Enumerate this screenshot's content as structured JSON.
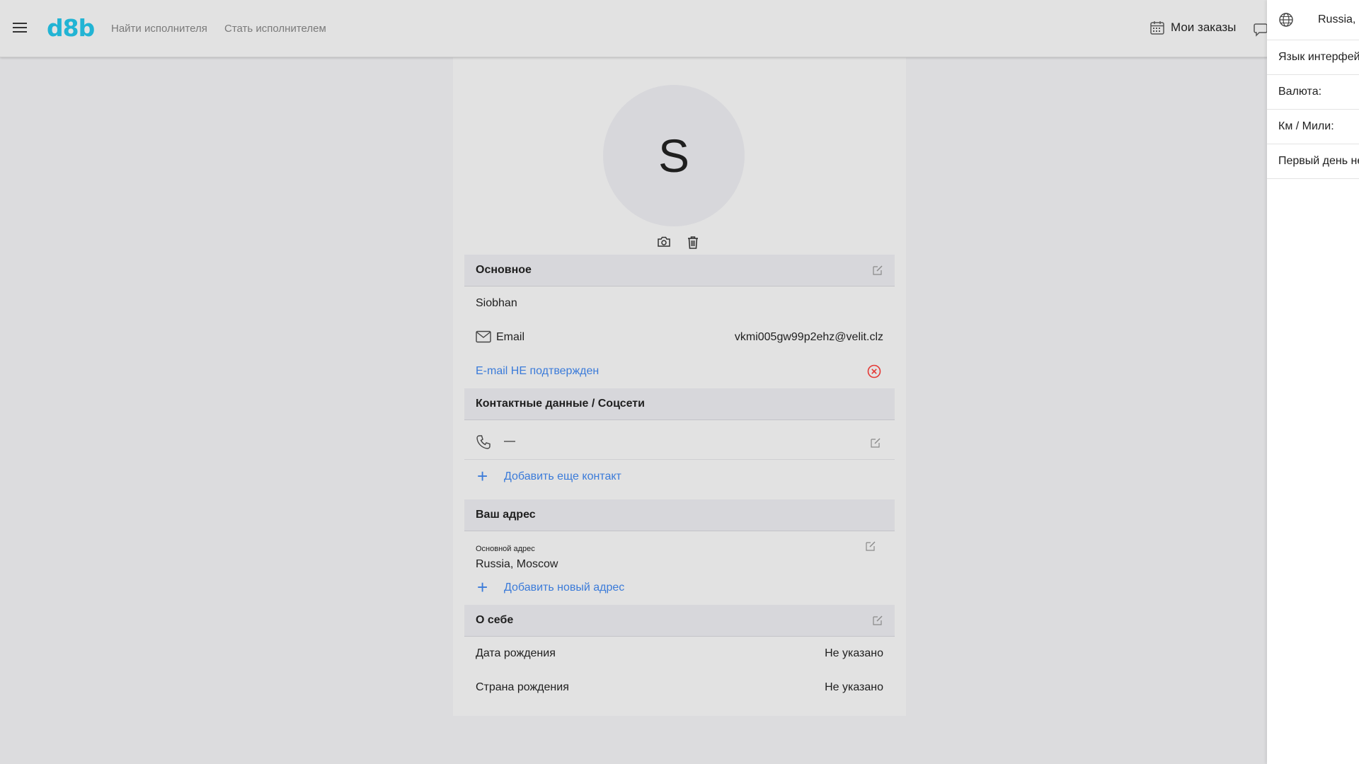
{
  "header": {
    "logo": "d8b",
    "nav": [
      "Найти исполнителя",
      "Стать исполнителем"
    ],
    "orders_label": "Мои заказы"
  },
  "right_panel": {
    "region": "Russia, R",
    "items": [
      "Язык интерфейса",
      "Валюта:",
      "Км / Мили:",
      "Первый день недели"
    ]
  },
  "profile": {
    "avatar_letter": "S",
    "basic": {
      "title": "Основное",
      "name": "Siobhan",
      "email_label": "Email",
      "email_value": "vkmi005gw99p2ehz@velit.clz",
      "email_status": "E-mail НЕ подтвержден"
    },
    "contacts": {
      "title": "Контактные данные / Соцсети",
      "phone_value": "—",
      "add_contact": "Добавить еще контакт"
    },
    "address": {
      "title": "Ваш адрес",
      "main_label": "Основной адрес",
      "main_value": "Russia, Moscow",
      "add_address": "Добавить новый адрес"
    },
    "about": {
      "title": "О себе",
      "birth_date_label": "Дата рождения",
      "birth_date_value": "Не указано",
      "birth_country_label": "Страна рождения",
      "birth_country_value": "Не указано"
    }
  },
  "colors": {
    "accent_logo": "#22b4d4",
    "link": "#3b7bd9",
    "error": "#e53935"
  }
}
